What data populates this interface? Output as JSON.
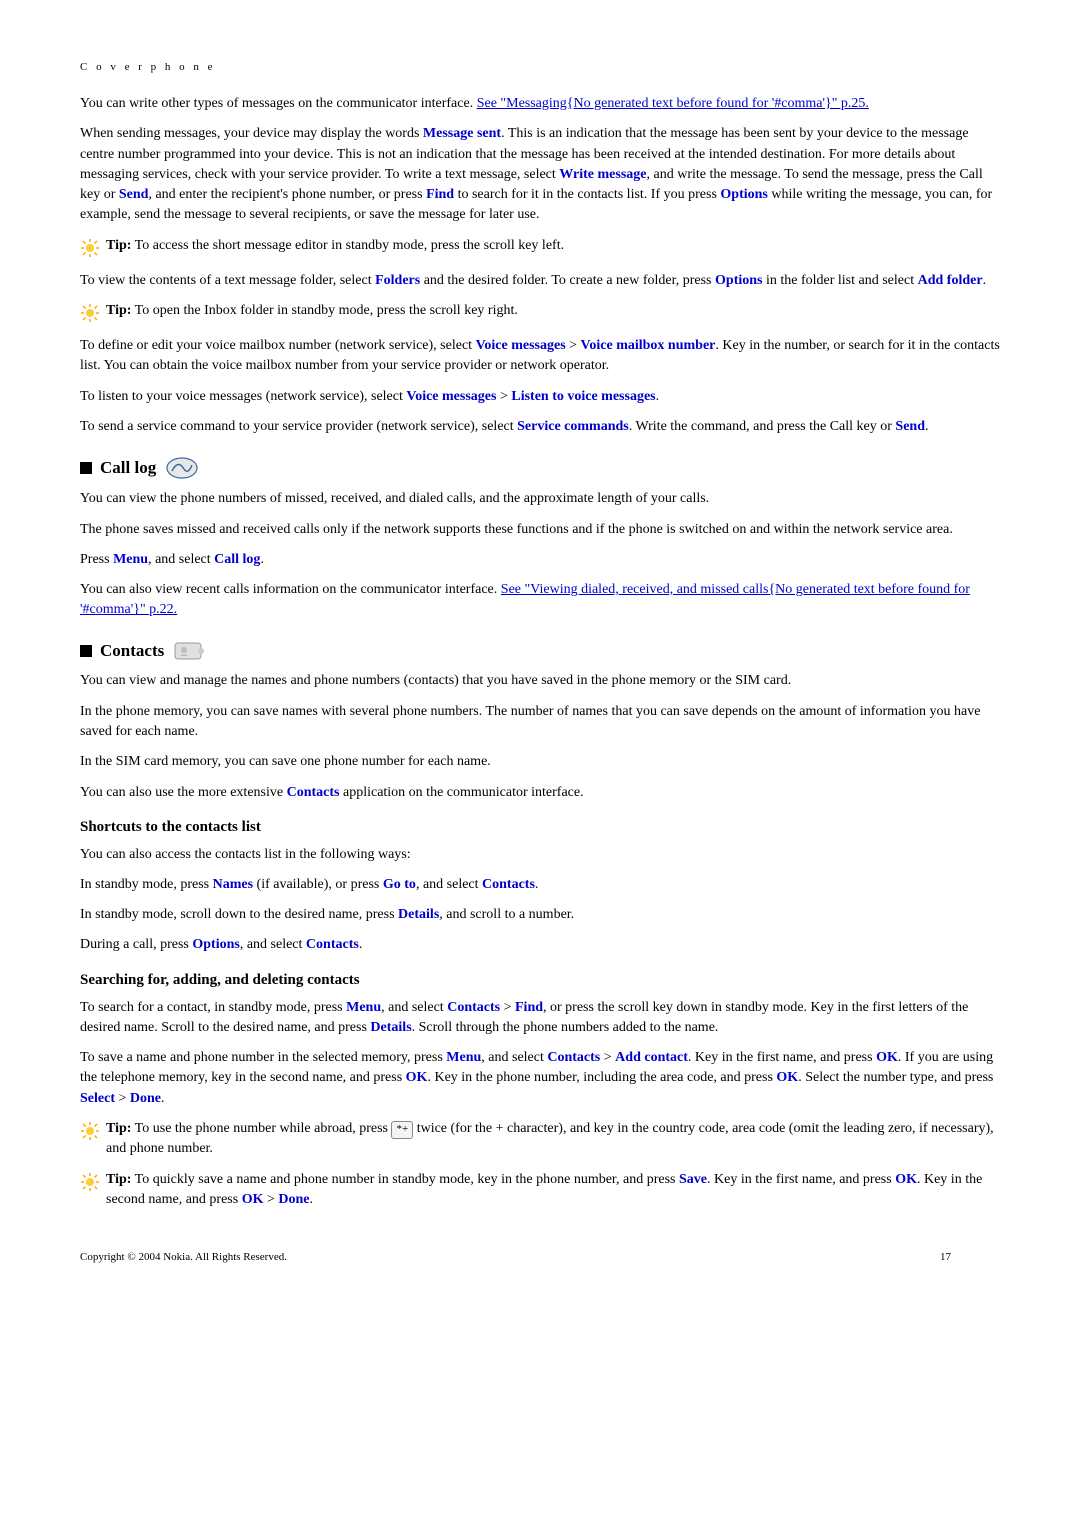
{
  "header": "C o v e r   p h o n e",
  "intro1a": "You can write other types of messages on the communicator interface. ",
  "intro1link": "See \"Messaging{No generated text before found for '#comma'}\" p.25.",
  "p2a": "When sending messages, your device may display the words ",
  "p2b": "Message sent",
  "p2c": ". This is an indication that the message has been sent by your device to the message centre number programmed into your device. This is not an indication that the message has been received at the intended destination. For more details about messaging services, check with your service provider. To write a text message, select ",
  "p2d": "Write message",
  "p2e": ", and write the message. To send the message, press the Call key or ",
  "p2f": "Send",
  "p2g": ", and enter the recipient's phone number, or press ",
  "p2h": "Find",
  "p2i": " to search for it in the contacts list. If you press ",
  "p2j": "Options",
  "p2k": " while writing the message, you can, for example, send the message to several recipients, or save the message for later use.",
  "tip1_label": "Tip:",
  "tip1_text": " To access the short message editor in standby mode, press the scroll key left.",
  "p3a": "To view the contents of a text message folder, select ",
  "p3b": "Folders",
  "p3c": " and the desired folder. To create a new folder, press ",
  "p3d": "Options",
  "p3e": " in the folder list and select ",
  "p3f": "Add folder",
  "p3g": ".",
  "tip2_label": "Tip:",
  "tip2_text": " To open the Inbox folder in standby mode, press the scroll key right.",
  "p4a": "To define or edit your voice mailbox number (network service), select ",
  "p4b": "Voice messages",
  "p4c": " > ",
  "p4d": " Voice mailbox number",
  "p4e": ". Key in the number, or search for it in the contacts list. You can obtain the voice mailbox number from your service provider or network operator.",
  "p5a": "To listen to your voice messages (network service), select ",
  "p5b": "Voice messages",
  "p5c": " > ",
  "p5d": " Listen to voice messages",
  "p5e": ".",
  "p6a": "To send a service command to your service provider (network service), select ",
  "p6b": "Service commands",
  "p6c": ". Write the command, and press the Call key or ",
  "p6d": "Send",
  "p6e": ".",
  "sec_calllog": "Call log",
  "cl1": "You can view the phone numbers of missed, received, and dialed calls, and the approximate length of your calls.",
  "cl2": "The phone saves missed and received calls only if the network supports these functions and if the phone is switched on and within the network service area.",
  "cl3a": "Press ",
  "cl3b": "Menu",
  "cl3c": ", and select ",
  "cl3d": "Call log",
  "cl3e": ".",
  "cl4a": "You can also view recent calls information on the communicator interface. ",
  "cl4link": "See \"Viewing dialed, received, and missed calls{No generated text before found for '#comma'}\" p.22.",
  "sec_contacts": "Contacts",
  "ct1": "You can view and manage the names and phone numbers (contacts) that you have saved in the phone memory or the SIM card.",
  "ct2": "In the phone memory, you can save names with several phone numbers. The number of names that you can save depends on the amount of information you have saved for each name.",
  "ct3": "In the SIM card memory, you can save one phone number for each name.",
  "ct4a": "You can also use the more extensive ",
  "ct4b": "Contacts",
  "ct4c": " application on the communicator interface.",
  "sub_shortcuts": "Shortcuts to the contacts list",
  "sc1": "You can also access the contacts list in the following ways:",
  "sc2a": "In standby mode, press ",
  "sc2b": "Names",
  "sc2c": " (if available), or press ",
  "sc2d": "Go to",
  "sc2e": ", and select ",
  "sc2f": "Contacts",
  "sc2g": ".",
  "sc3a": "In standby mode, scroll down to the desired name, press ",
  "sc3b": "Details",
  "sc3c": ", and scroll to a number.",
  "sc4a": "During a call, press ",
  "sc4b": "Options",
  "sc4c": ", and select ",
  "sc4d": "Contacts",
  "sc4e": ".",
  "sub_search": "Searching for, adding, and deleting contacts",
  "sr1a": "To search for a contact, in standby mode, press ",
  "sr1b": "Menu",
  "sr1c": ", and select ",
  "sr1d": "Contacts",
  "sr1e": " > ",
  "sr1f": " Find",
  "sr1g": ", or press the scroll key down in standby mode. Key in the first letters of the desired name. Scroll to the desired name, and press ",
  "sr1h": "Details",
  "sr1i": ". Scroll through the phone numbers added to the name.",
  "sr2a": "To save a name and phone number in the selected memory, press ",
  "sr2b": "Menu",
  "sr2c": ", and select ",
  "sr2d": "Contacts",
  "sr2e": " > ",
  "sr2f": " Add contact",
  "sr2g": ". Key in the first name, and press ",
  "sr2h": "OK",
  "sr2i": ". If you are using the telephone memory, key in the second name, and press ",
  "sr2j": "OK",
  "sr2k": ". Key in the phone number, including the area code, and press ",
  "sr2l": "OK",
  "sr2m": ". Select the number type, and press ",
  "sr2n": "Select",
  "sr2o": " > ",
  "sr2p": " Done",
  "sr2q": ".",
  "tip3_label": "Tip:",
  "tip3a": " To use the phone number while abroad, press ",
  "tip3key": "*+",
  "tip3b": " twice (for the + character), and key in the country code, area code (omit the leading zero, if necessary), and phone number.",
  "tip4_label": "Tip:",
  "tip4a": "  To quickly save a name and phone number in standby mode, key in the phone number, and press ",
  "tip4b": "Save",
  "tip4c": ". Key in the first name, and press ",
  "tip4d": "OK",
  "tip4e": ". Key in the second name, and press ",
  "tip4f": "OK",
  "tip4g": " > ",
  "tip4h": " Done",
  "tip4i": ".",
  "footer_copy": "Copyright © 2004 Nokia. All Rights Reserved.",
  "footer_page": "17"
}
